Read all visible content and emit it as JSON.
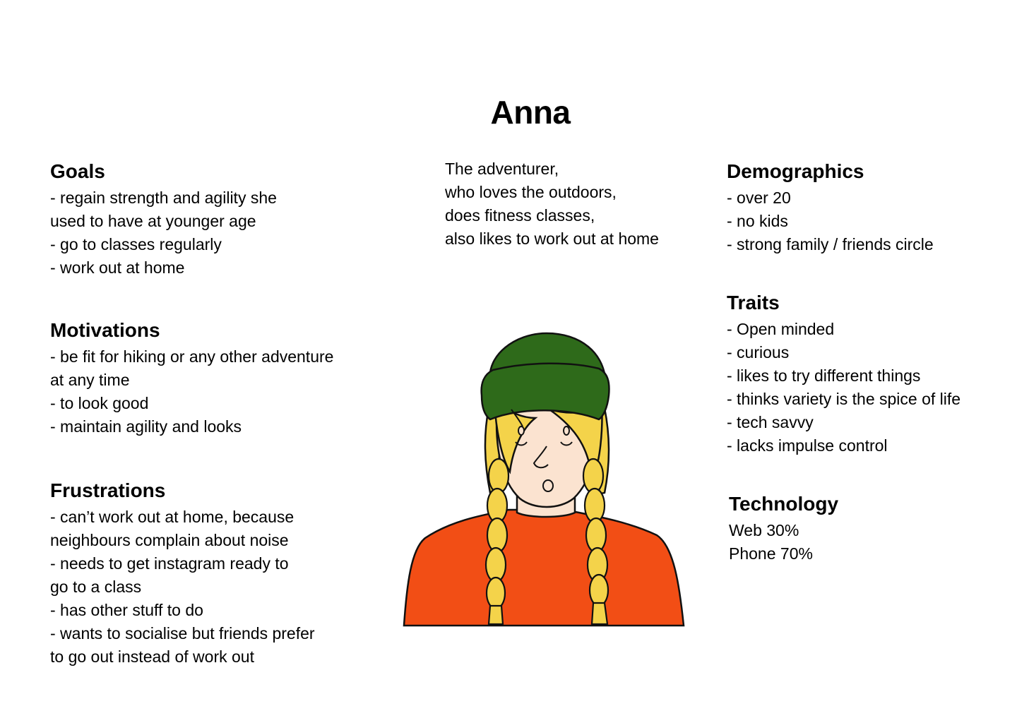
{
  "persona": {
    "name": "Anna",
    "tagline": [
      "The adventurer,",
      "who loves  the outdoors,",
      "does fitness classes,",
      "also likes to work out at home"
    ]
  },
  "goals": {
    "heading": "Goals",
    "lines": [
      "- regain strength and agility she",
      "used to have at younger age",
      "- go to classes regularly",
      "- work out at home"
    ]
  },
  "motivations": {
    "heading": "Motivations",
    "lines": [
      "- be fit for hiking or any other adventure",
      "at any time",
      "- to look good",
      "- maintain agility and looks"
    ]
  },
  "frustrations": {
    "heading": "Frustrations",
    "lines": [
      "- can’t work out at home, because",
      "neighbours complain about noise",
      "- needs to get instagram ready to",
      "go to a class",
      "- has other stuff to do",
      "- wants to socialise but friends prefer",
      "to go out instead of work out"
    ]
  },
  "demographics": {
    "heading": "Demographics",
    "lines": [
      "- over 20",
      "- no kids",
      "- strong family / friends circle"
    ]
  },
  "traits": {
    "heading": "Traits",
    "lines": [
      "- Open minded",
      "- curious",
      "- likes to try different things",
      "- thinks variety is the spice of life",
      "- tech savvy",
      "- lacks impulse control"
    ]
  },
  "technology": {
    "heading": "Technology",
    "lines": [
      "Web 30%",
      "Phone 70%"
    ]
  },
  "illustration": {
    "icon": "persona-avatar-illustration",
    "colors": {
      "beanie": "#2e6a1a",
      "hair": "#f4d34a",
      "skin": "#fbe3d0",
      "shirt": "#f24e15",
      "outline": "#111111"
    }
  }
}
